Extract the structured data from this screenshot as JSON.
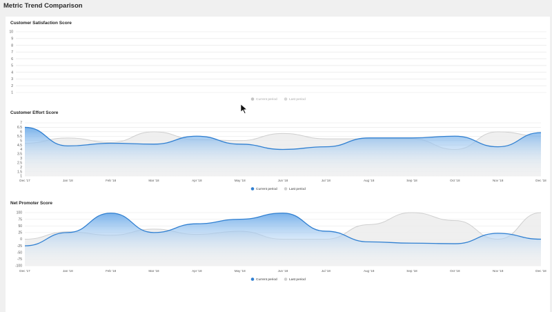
{
  "page": {
    "title": "Metric Trend Comparison"
  },
  "colors": {
    "current": "#2f7fd1",
    "current_fill_top": "#6aa9e8",
    "last": "#cfcfcf",
    "last_fill": "#ececec",
    "grid": "#e3e3e3",
    "legend_muted": "#c4c4c4"
  },
  "legend": {
    "current_label": "Current period",
    "last_label": "Last period"
  },
  "chart_data": [
    {
      "type": "area",
      "title": "Customer Satisfaction Score",
      "ylim": [
        1,
        10
      ],
      "yticks": [
        "1",
        "2",
        "3",
        "4",
        "5",
        "6",
        "7",
        "8",
        "9",
        "10"
      ],
      "grid": true,
      "legend_position": "bottom-center",
      "legend_muted": true,
      "categories": [],
      "series": [
        {
          "name": "Current period",
          "values": []
        },
        {
          "name": "Last period",
          "values": []
        }
      ]
    },
    {
      "type": "area",
      "title": "Customer Effort Score",
      "ylim": [
        1,
        7
      ],
      "yticks": [
        "1",
        "1.5",
        "2",
        "2.5",
        "3",
        "3.5",
        "4",
        "4.5",
        "5",
        "5.5",
        "6",
        "6.5",
        "7"
      ],
      "grid": true,
      "legend_position": "bottom-center",
      "categories": [
        "Dec '17",
        "Jan '18",
        "Feb '18",
        "Mar '18",
        "Apr '18",
        "May '18",
        "Jun '18",
        "Jul '18",
        "Aug '18",
        "Sep '18",
        "Oct '18",
        "Nov '18",
        "Dec '18"
      ],
      "series": [
        {
          "name": "Current period",
          "values": [
            6.5,
            4.4,
            4.7,
            4.6,
            5.5,
            4.6,
            4.0,
            4.3,
            5.3,
            5.3,
            5.5,
            4.3,
            5.9
          ]
        },
        {
          "name": "Last period",
          "values": [
            4.7,
            5.3,
            4.8,
            6.0,
            5.1,
            5.0,
            5.8,
            5.2,
            5.2,
            5.2,
            4.0,
            6.0,
            5.5
          ]
        }
      ]
    },
    {
      "type": "area",
      "title": "Net Promoter Score",
      "ylim": [
        -100,
        100
      ],
      "yticks": [
        "-100",
        "-75",
        "-50",
        "-25",
        "0",
        "25",
        "50",
        "75",
        "100"
      ],
      "grid": true,
      "legend_position": "bottom-center",
      "categories": [
        "Dec '17",
        "Jan '18",
        "Feb '18",
        "Mar '18",
        "Apr '18",
        "May '18",
        "Jun '18",
        "Jul '18",
        "Aug '18",
        "Sep '18",
        "Oct '18",
        "Nov '18",
        "Dec '18"
      ],
      "series": [
        {
          "name": "Current period",
          "values": [
            -25,
            25,
            98,
            25,
            58,
            75,
            98,
            30,
            -10,
            -15,
            -17,
            22,
            0
          ]
        },
        {
          "name": "Last period",
          "values": [
            0,
            28,
            15,
            38,
            18,
            30,
            0,
            0,
            55,
            100,
            70,
            0,
            100
          ]
        }
      ]
    }
  ]
}
